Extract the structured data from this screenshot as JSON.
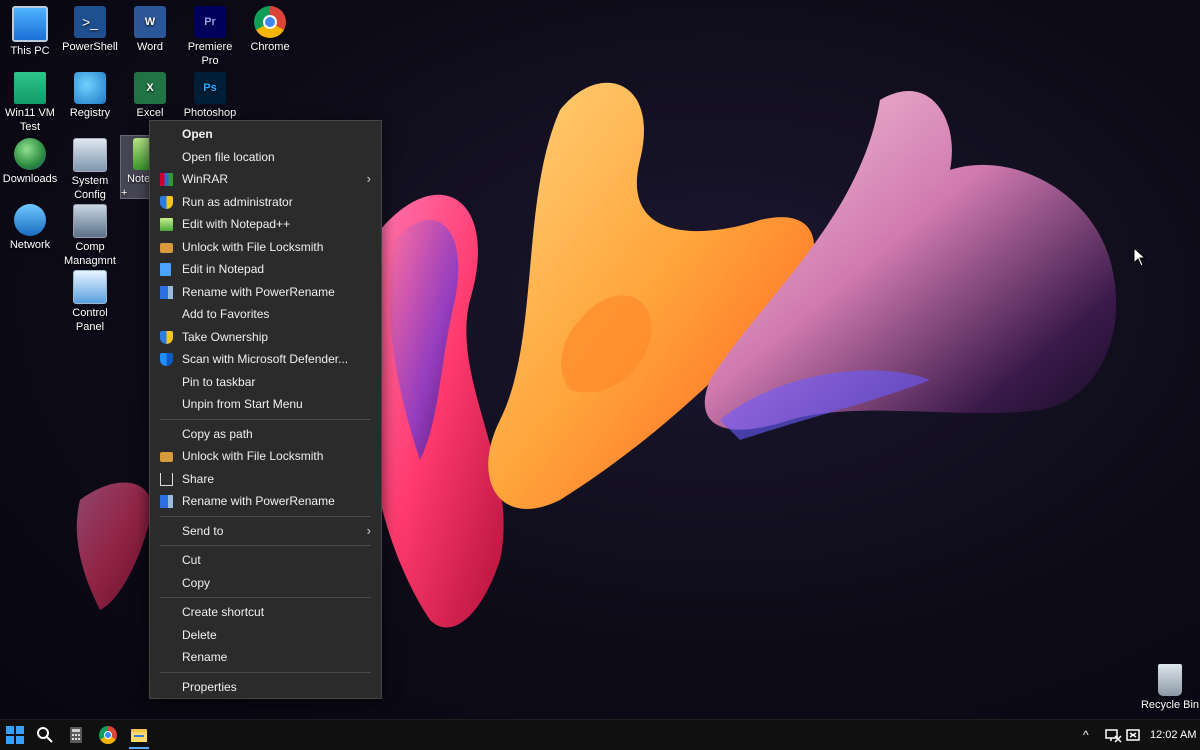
{
  "desktop": {
    "icons": [
      {
        "label": "This PC",
        "icon": "monitor-icon"
      },
      {
        "label": "PowerShell",
        "icon": "powershell-icon"
      },
      {
        "label": "Word",
        "icon": "word-icon"
      },
      {
        "label": "Premiere Pro",
        "icon": "premiere-icon",
        "glyph": "Pr"
      },
      {
        "label": "Chrome",
        "icon": "chrome-icon"
      },
      {
        "label": "Win11 VM Test",
        "icon": "folder-icon"
      },
      {
        "label": "Registry",
        "icon": "registry-icon"
      },
      {
        "label": "Excel",
        "icon": "excel-icon",
        "glyph": "X"
      },
      {
        "label": "Photoshop",
        "icon": "photoshop-icon",
        "glyph": "Ps"
      },
      {
        "label": "Downloads",
        "icon": "downloads-globe-icon"
      },
      {
        "label": "System Config",
        "icon": "system-config-icon"
      },
      {
        "label": "Note +",
        "icon": "notepad-plus-icon"
      },
      {
        "label": "Network",
        "icon": "network-icon"
      },
      {
        "label": "Comp Managmnt",
        "icon": "computer-management-icon"
      },
      {
        "label": "Control Panel",
        "icon": "control-panel-icon"
      },
      {
        "label": "Recycle Bin",
        "icon": "recycle-bin-icon"
      }
    ]
  },
  "context_menu": {
    "items": [
      {
        "label": "Open",
        "icon": ""
      },
      {
        "label": "Open file location",
        "icon": ""
      },
      {
        "label": "WinRAR",
        "icon": "winrar-icon"
      },
      {
        "label": "Run as administrator",
        "icon": "uac-shield-icon"
      },
      {
        "label": "Edit with Notepad++",
        "icon": "notepad-plus-icon"
      },
      {
        "label": "Unlock with File Locksmith",
        "icon": "lock-icon"
      },
      {
        "label": "Edit in Notepad",
        "icon": "notepad-icon"
      },
      {
        "label": "Rename with PowerRename",
        "icon": "powerrename-icon"
      },
      {
        "label": "Add to Favorites",
        "icon": ""
      },
      {
        "label": "Take Ownership",
        "icon": "uac-shield-icon"
      },
      {
        "label": "Scan with Microsoft Defender...",
        "icon": "defender-shield-icon"
      },
      {
        "label": "Pin to taskbar",
        "icon": ""
      },
      {
        "label": "Unpin from Start Menu",
        "icon": ""
      },
      {
        "label": "Copy as path",
        "icon": ""
      },
      {
        "label": "Unlock with File Locksmith",
        "icon": "lock-icon"
      },
      {
        "label": "Share",
        "icon": "share-icon"
      },
      {
        "label": "Rename with PowerRename",
        "icon": "powerrename-icon"
      },
      {
        "label": "Send to",
        "icon": ""
      },
      {
        "label": "Cut",
        "icon": ""
      },
      {
        "label": "Copy",
        "icon": ""
      },
      {
        "label": "Create shortcut",
        "icon": ""
      },
      {
        "label": "Delete",
        "icon": ""
      },
      {
        "label": "Rename",
        "icon": ""
      },
      {
        "label": "Properties",
        "icon": ""
      }
    ],
    "submenu_arrow": "›"
  },
  "taskbar": {
    "pinned": [
      "start-icon",
      "search-icon",
      "calculator-icon",
      "chrome-icon",
      "file-explorer-icon"
    ],
    "tray": {
      "chevron": "^",
      "time": "12:02 AM"
    }
  },
  "colors": {
    "menu_bg": "#2b2b2b",
    "taskbar_bg": "#101010",
    "accent_blue": "#0078d4"
  }
}
